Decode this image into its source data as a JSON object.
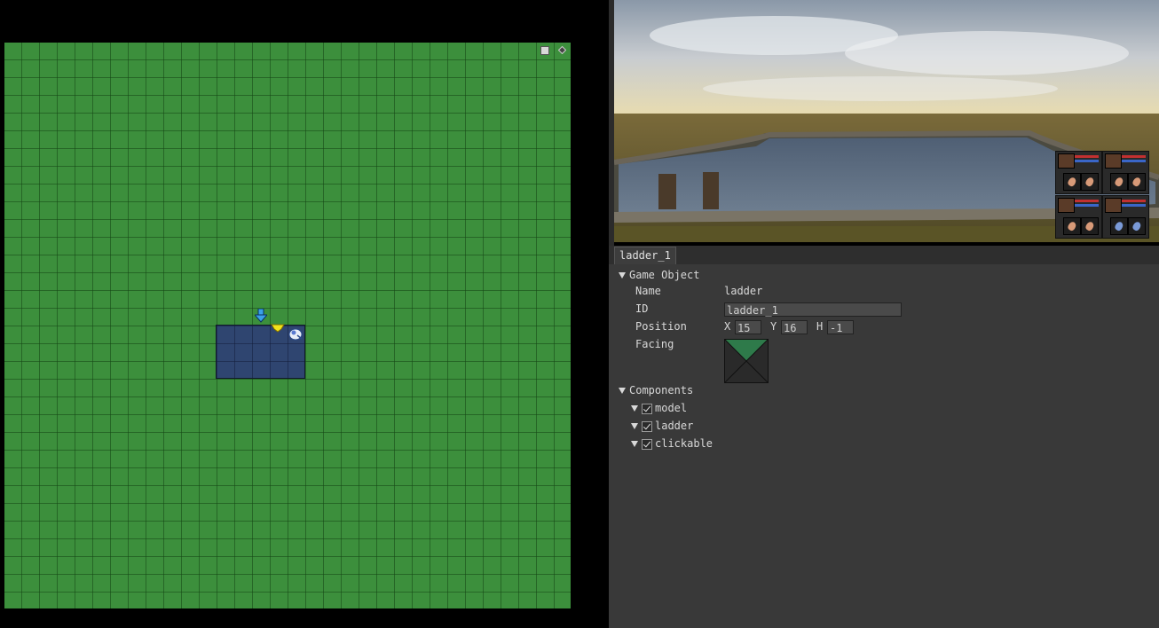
{
  "map": {
    "tool_square_icon": "square-icon",
    "tool_diamond_icon": "diamond-icon",
    "ground_color": "#3c8f3c",
    "water_color": "#2f4570"
  },
  "inspector": {
    "tab_label": "ladder_1",
    "game_object": {
      "section_label": "Game Object",
      "name_label": "Name",
      "name_value": "ladder",
      "id_label": "ID",
      "id_value": "ladder_1",
      "position_label": "Position",
      "x_label": "X",
      "x_value": "15",
      "y_label": "Y",
      "y_value": "16",
      "h_label": "H",
      "h_value": "-1",
      "facing_label": "Facing"
    },
    "components": {
      "section_label": "Components",
      "items": [
        {
          "label": "model",
          "enabled": true
        },
        {
          "label": "ladder",
          "enabled": true
        },
        {
          "label": "clickable",
          "enabled": true
        }
      ]
    }
  }
}
